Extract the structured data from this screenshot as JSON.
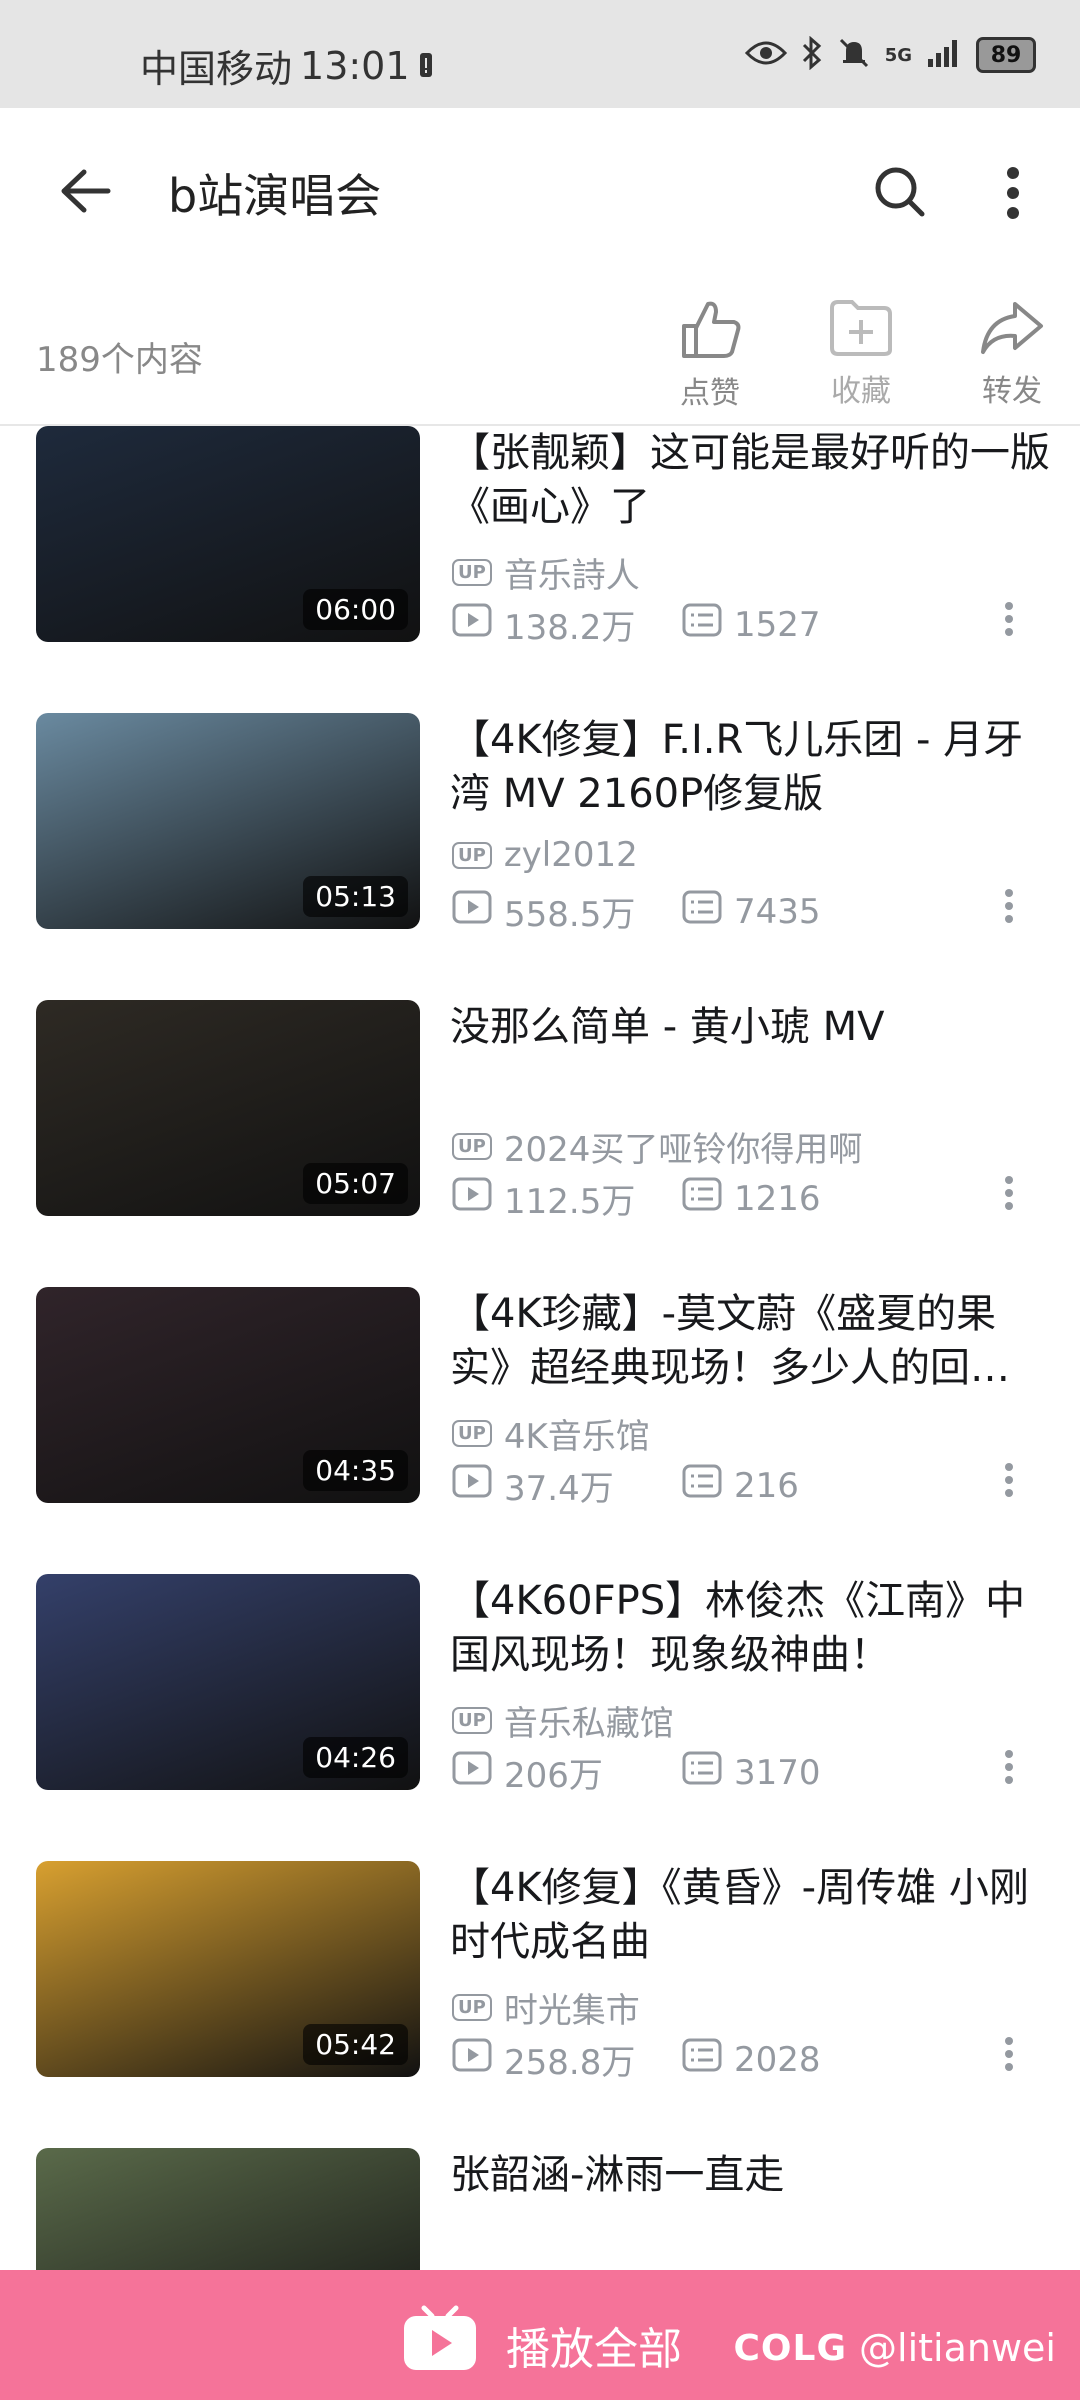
{
  "status_bar": {
    "carrier": "中国移动",
    "time": "13:01",
    "network": "5G",
    "battery": "89"
  },
  "header": {
    "title": "b站演唱会"
  },
  "info": {
    "count": "189个内容",
    "actions": [
      {
        "label": "点赞",
        "icon": "thumbs-up-icon"
      },
      {
        "label": "收藏",
        "icon": "folder-add-icon"
      },
      {
        "label": "转发",
        "icon": "share-icon"
      }
    ]
  },
  "videos": [
    {
      "title": "【张靓颖】这可能是最好听的一版《画心》了",
      "uploader": "音乐詩人",
      "views": "138.2万",
      "comments": "1527",
      "duration": "06:00",
      "bg": "#1e2a3c"
    },
    {
      "title": "【4K修复】F.I.R飞儿乐团 - 月牙湾 MV 2160P修复版",
      "uploader": "zyl2012",
      "views": "558.5万",
      "comments": "7435",
      "duration": "05:13",
      "bg": "#6a8aa0"
    },
    {
      "title": "没那么简单 - 黄小琥 MV",
      "uploader": "2024买了哑铃你得用啊",
      "views": "112.5万",
      "comments": "1216",
      "duration": "05:07",
      "bg": "#2e2a24"
    },
    {
      "title": "【4K珍藏】-莫文蔚《盛夏的果实》超经典现场！多少人的回…",
      "uploader": "4K音乐馆",
      "views": "37.4万",
      "comments": "216",
      "duration": "04:35",
      "bg": "#30242a"
    },
    {
      "title": "【4K60FPS】林俊杰《江南》中国风现场！现象级神曲！",
      "uploader": "音乐私藏馆",
      "views": "206万",
      "comments": "3170",
      "duration": "04:26",
      "bg": "#34406a"
    },
    {
      "title": "【4K修复】《黄昏》-周传雄 小刚时代成名曲",
      "uploader": "时光集市",
      "views": "258.8万",
      "comments": "2028",
      "duration": "05:42",
      "bg": "#d8a030"
    },
    {
      "title": "张韶涵-淋雨一直走",
      "uploader": "",
      "views": "",
      "comments": "",
      "duration": "",
      "bg": "#5a6a4a"
    }
  ],
  "bottom": {
    "play_all": "播放全部",
    "watermark_logo": "COLG",
    "watermark_user": "@litianwei"
  }
}
